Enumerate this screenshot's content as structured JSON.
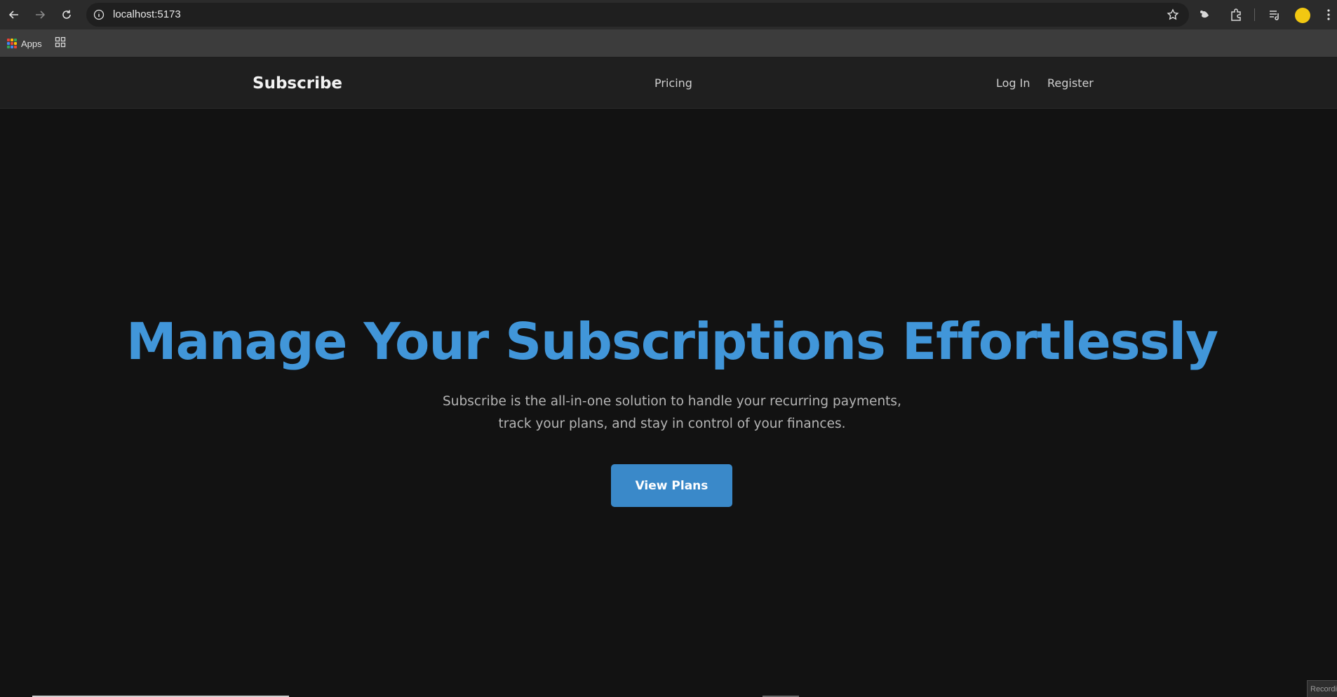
{
  "browser": {
    "url": "localhost:5173",
    "bookmarks": {
      "apps_label": "Apps"
    },
    "profile_color": "#f2c811"
  },
  "header": {
    "brand": "Subscribe",
    "nav": {
      "pricing": "Pricing",
      "login": "Log In",
      "register": "Register"
    }
  },
  "hero": {
    "title": "Manage Your Subscriptions Effortlessly",
    "subtitle_line1": "Subscribe is the all-in-one solution to handle your recurring payments,",
    "subtitle_line2": "track your plans, and stay in control of your finances.",
    "cta": "View Plans",
    "accent_color": "#4196d9"
  },
  "corner_text": "Recording"
}
